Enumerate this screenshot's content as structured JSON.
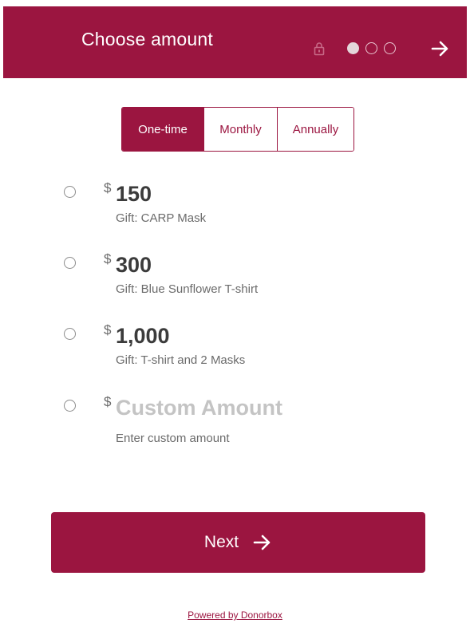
{
  "header": {
    "title": "Choose amount",
    "lock_icon": "lock-icon",
    "steps_total": 3,
    "step_current": 1,
    "forward_icon": "arrow-right-icon"
  },
  "colors": {
    "brand": "#9b1540",
    "text_dark": "#3b3b3b",
    "text_muted": "#6b6b6b",
    "placeholder": "#c4c4c4"
  },
  "frequency": {
    "tabs": [
      {
        "label": "One-time",
        "selected": true
      },
      {
        "label": "Monthly",
        "selected": false
      },
      {
        "label": "Annually",
        "selected": false
      }
    ]
  },
  "options": [
    {
      "currency": "$",
      "amount": "150",
      "gift": "Gift: CARP Mask",
      "selected": false
    },
    {
      "currency": "$",
      "amount": "300",
      "gift": "Gift: Blue Sunflower T-shirt",
      "selected": false
    },
    {
      "currency": "$",
      "amount": "1,000",
      "gift": "Gift: T-shirt and 2 Masks",
      "selected": false
    }
  ],
  "custom": {
    "currency": "$",
    "placeholder": "Custom Amount",
    "hint": "Enter custom amount",
    "selected": false
  },
  "next_button": {
    "label": "Next",
    "icon": "arrow-right-icon"
  },
  "footer": {
    "powered_by": "Powered by Donorbox"
  }
}
